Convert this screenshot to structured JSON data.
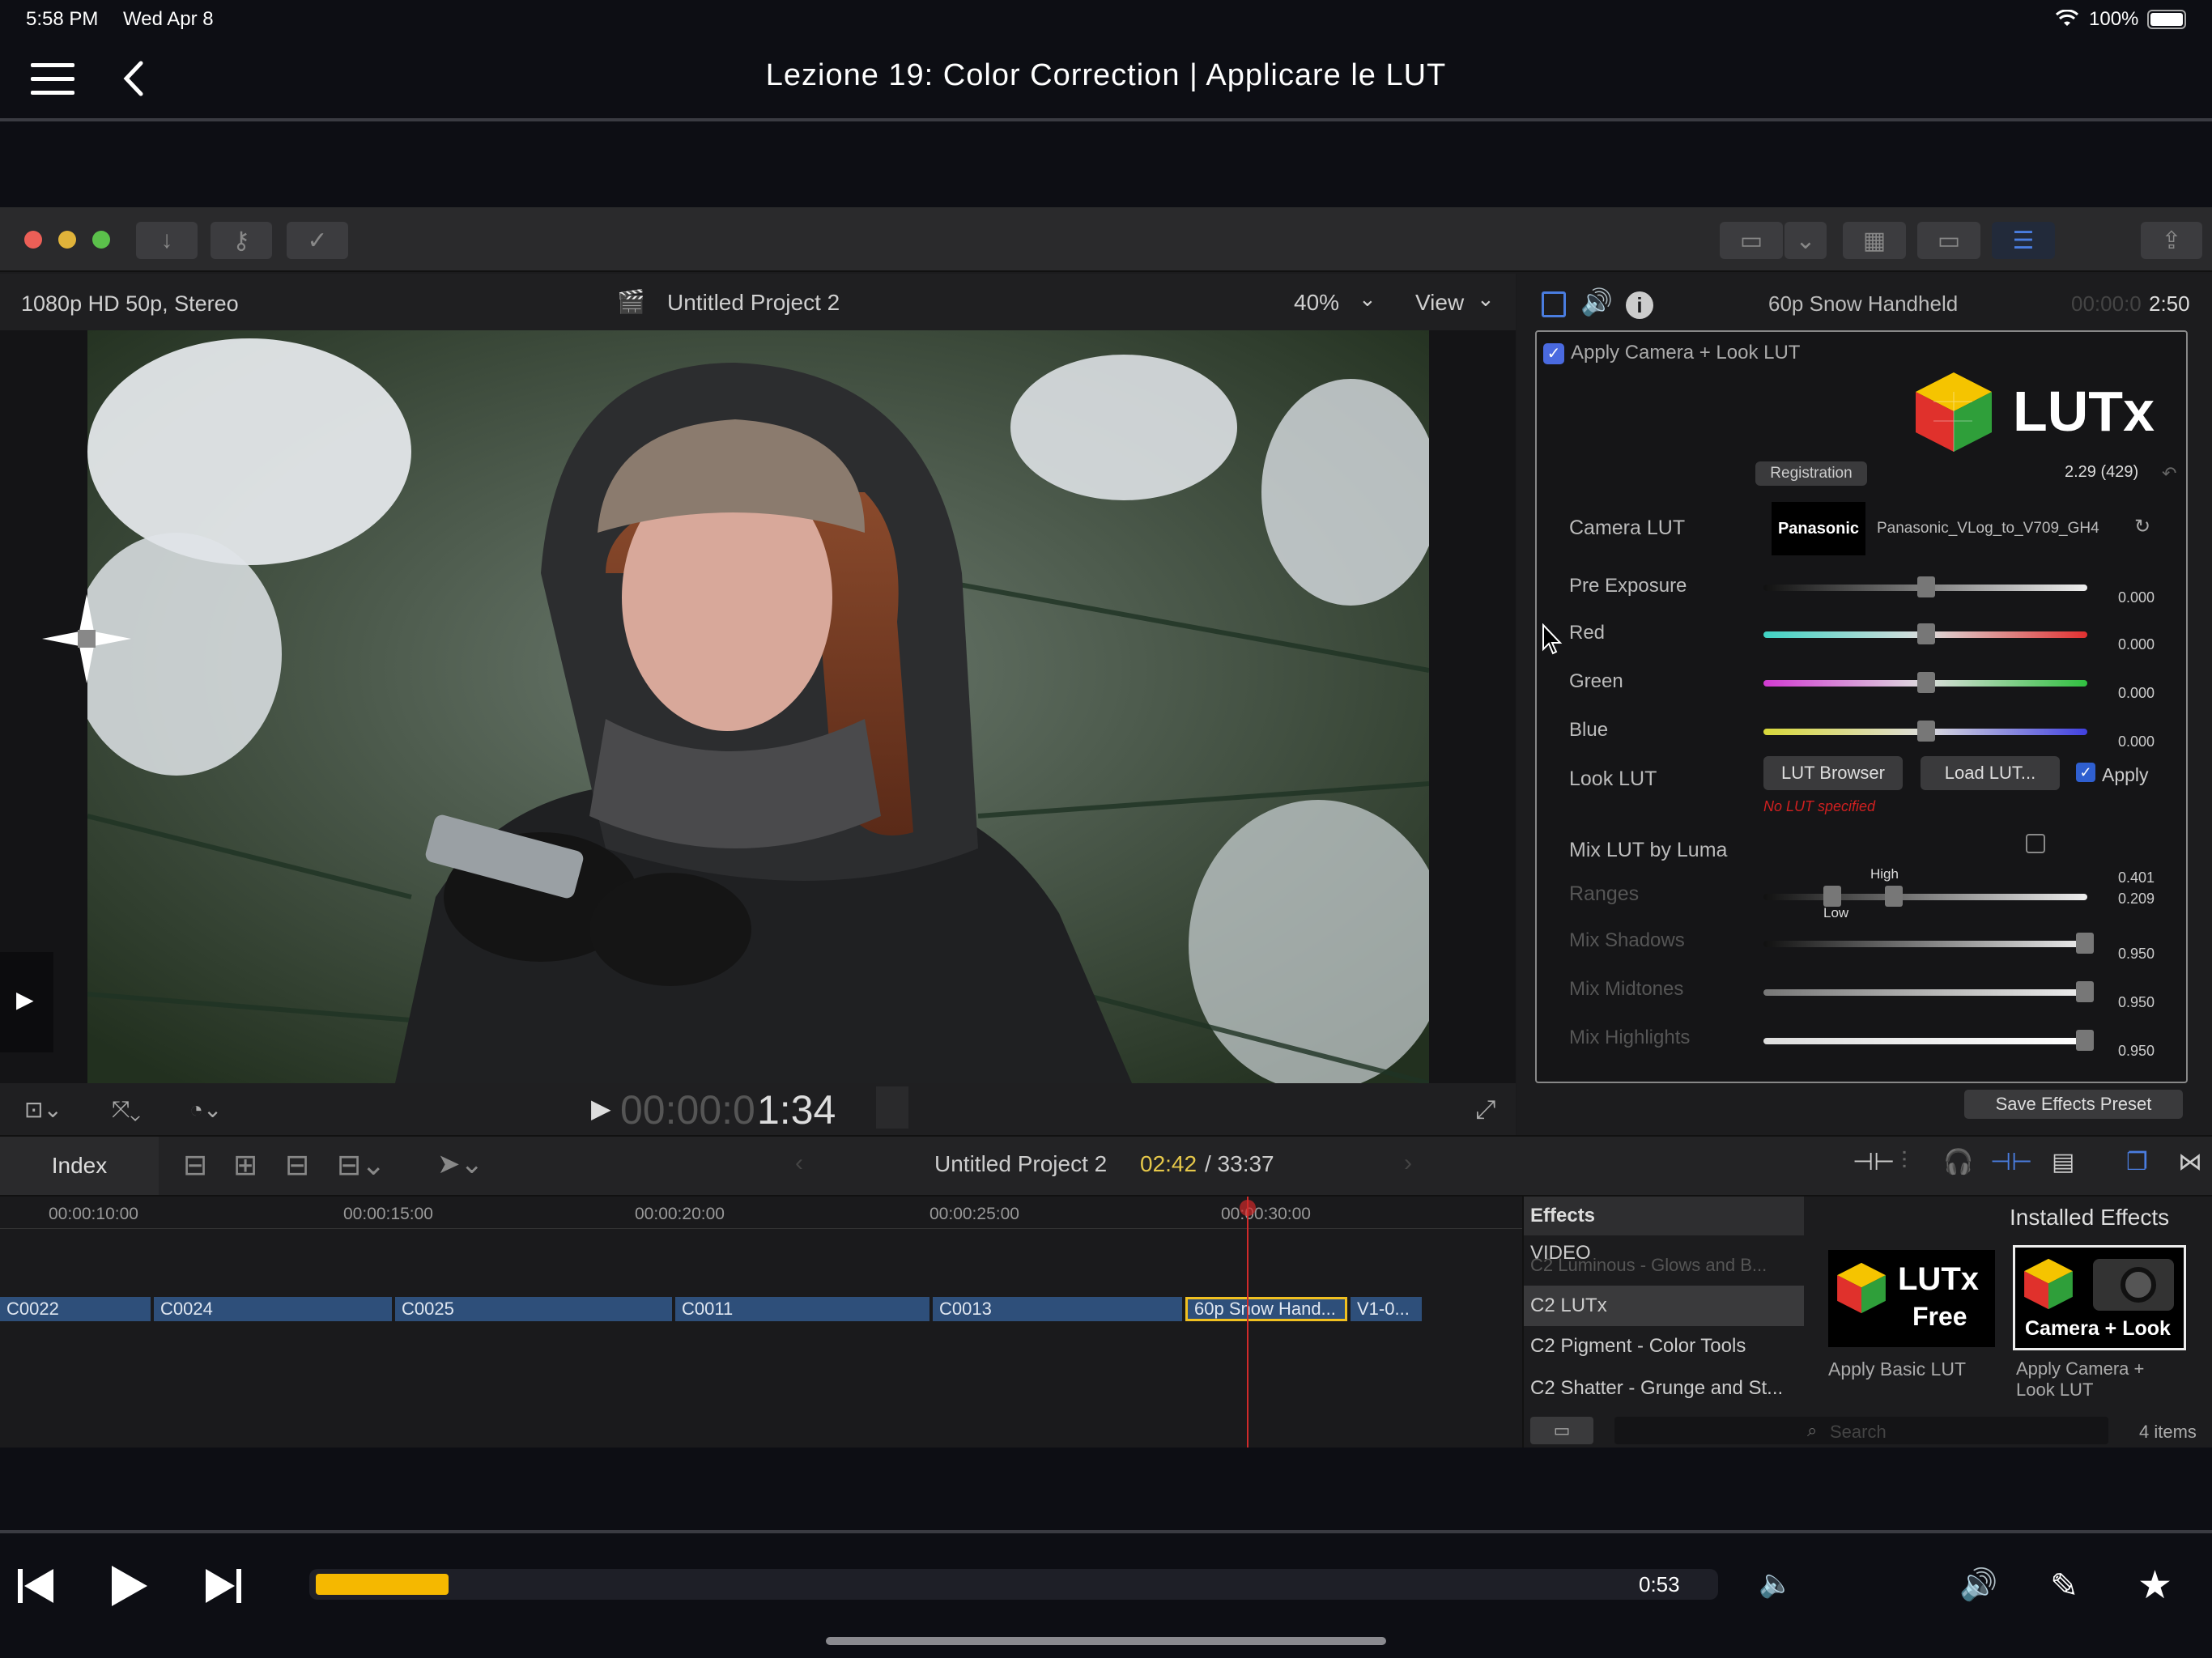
{
  "status_bar": {
    "time": "5:58 PM",
    "date": "Wed Apr 8",
    "battery": "100%"
  },
  "nav": {
    "title": "Lezione 19: Color Correction | Applicare le LUT"
  },
  "viewer": {
    "format": "1080p HD 50p, Stereo",
    "project": "Untitled Project 2",
    "zoom": "40%",
    "view_label": "View",
    "timecode_dim": "00:00:0",
    "timecode": "1:34"
  },
  "inspector": {
    "clip_name": "60p Snow Handheld",
    "duration_dim": "00:00:0",
    "duration": "2:50",
    "effect_name": "Apply Camera + Look LUT",
    "logo_text": "LUTx",
    "registration_label": "Registration",
    "version": "2.29 (429)",
    "camera_lut_label": "Camera LUT",
    "camera_brand": "Panasonic",
    "camera_lut_file": "Panasonic_VLog_to_V709_GH4",
    "params": [
      {
        "label": "Pre Exposure",
        "value": "0.000"
      },
      {
        "label": "Red",
        "value": "0.000"
      },
      {
        "label": "Green",
        "value": "0.000"
      },
      {
        "label": "Blue",
        "value": "0.000"
      }
    ],
    "look_lut_label": "Look LUT",
    "lut_browser_label": "LUT Browser",
    "load_lut_label": "Load LUT...",
    "apply_label": "Apply",
    "no_lut_text": "No LUT specified",
    "mix_luma_label": "Mix LUT by Luma",
    "ranges_label": "Ranges",
    "ranges_high_value": "0.401",
    "ranges_low_value": "0.209",
    "high_label": "High",
    "low_label": "Low",
    "mix_params": [
      {
        "label": "Mix Shadows",
        "value": "0.950"
      },
      {
        "label": "Mix Midtones",
        "value": "0.950"
      },
      {
        "label": "Mix Highlights",
        "value": "0.950"
      }
    ],
    "save_preset_label": "Save Effects Preset"
  },
  "timeline": {
    "index_label": "Index",
    "project": "Untitled Project 2",
    "position": "02:42",
    "total": "/ 33:37",
    "ruler": [
      "00:00:10:00",
      "00:00:15:00",
      "00:00:20:00",
      "00:00:25:00",
      "00:00:30:00"
    ],
    "clips": [
      "C0022",
      "C0024",
      "C0025",
      "C0011",
      "C0013",
      "60p Snow Hand...",
      "V1-0..."
    ]
  },
  "effects": {
    "header": "Effects",
    "installed": "Installed Effects",
    "video_label": "VIDEO",
    "faded_item": "C2 Luminous - Glows and B...",
    "list": [
      "C2 LUTx",
      "C2 Pigment - Color Tools",
      "C2 Shatter - Grunge and St..."
    ],
    "thumb1_title": "LUTx",
    "thumb1_sub": "Free",
    "thumb1_caption": "Apply Basic LUT",
    "thumb2_title": "Camera + Look",
    "thumb2_caption_1": "Apply Camera +",
    "thumb2_caption_2": "Look LUT",
    "search_placeholder": "Search",
    "count": "4 items"
  },
  "player": {
    "elapsed": "0:53",
    "progress": 0.095,
    "accent": "#f5b800"
  }
}
